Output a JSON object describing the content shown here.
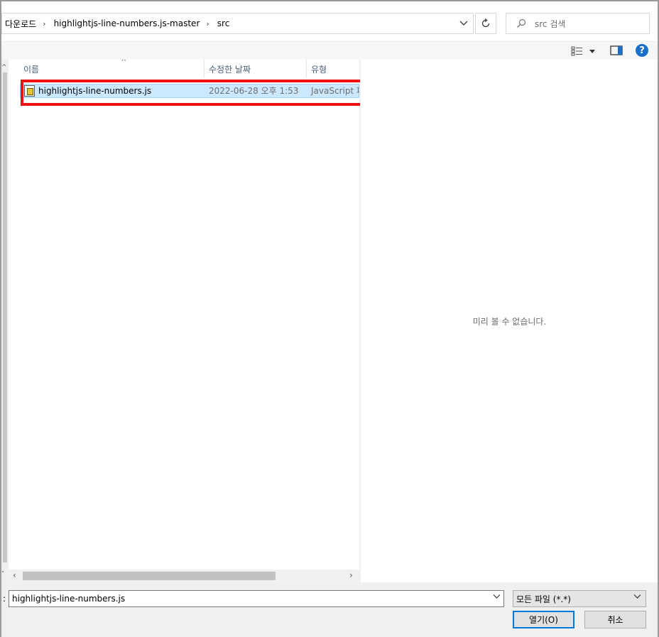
{
  "address_bar": {
    "crumbs": [
      "다운로드",
      "highlightjs-line-numbers.js-master",
      "src"
    ],
    "separator": "›",
    "dropdown_icon": "chevron-down-icon"
  },
  "refresh_icon": "refresh-icon",
  "search": {
    "placeholder": "src 검색",
    "icon": "search-icon"
  },
  "command_bar": {
    "view_icon": "details-view-icon",
    "preview_pane_icon": "preview-pane-icon",
    "help_label": "?"
  },
  "file_list": {
    "columns": [
      "이름",
      "수정한 날짜",
      "유형"
    ],
    "sort_indicator": "^",
    "rows": [
      {
        "name": "highlightjs-line-numbers.js",
        "modified": "2022-06-28 오후 1:53",
        "type": "JavaScript 파",
        "selected": true
      }
    ]
  },
  "preview": {
    "message": "미리 볼 수 없습니다."
  },
  "bottom": {
    "filename_label": ":",
    "filename_value": "highlightjs-line-numbers.js",
    "filetype_value": "모든 파일 (*.*)",
    "open_label": "열기(O)",
    "cancel_label": "취소"
  },
  "colors": {
    "selection": "#cce8ff",
    "highlight_box": "#ee1111",
    "accent": "#0078d7"
  }
}
